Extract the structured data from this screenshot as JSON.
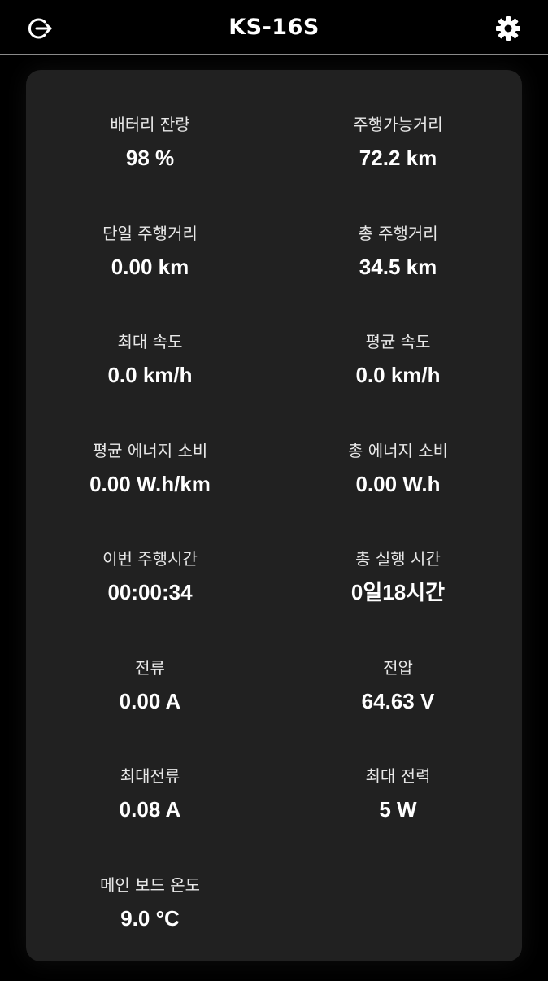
{
  "header": {
    "title": "KS-16S",
    "back_icon": "logout-icon",
    "settings_icon": "gear-icon"
  },
  "stats": [
    {
      "label": "배터리 잔량",
      "value": "98 %"
    },
    {
      "label": "주행가능거리",
      "value": "72.2 km"
    },
    {
      "label": "단일 주행거리",
      "value": "0.00 km"
    },
    {
      "label": "총 주행거리",
      "value": "34.5 km"
    },
    {
      "label": "최대 속도",
      "value": "0.0 km/h"
    },
    {
      "label": "평균 속도",
      "value": "0.0 km/h"
    },
    {
      "label": "평균 에너지 소비",
      "value": "0.00 W.h/km"
    },
    {
      "label": "총 에너지 소비",
      "value": "0.00 W.h"
    },
    {
      "label": "이번 주행시간",
      "value": "00:00:34"
    },
    {
      "label": "총 실행 시간",
      "value": "0일18시간"
    },
    {
      "label": "전류",
      "value": "0.00 A"
    },
    {
      "label": "전압",
      "value": "64.63 V"
    },
    {
      "label": "최대전류",
      "value": "0.08 A"
    },
    {
      "label": "최대 전력",
      "value": "5 W"
    },
    {
      "label": "메인 보드 온도",
      "value": "9.0 °C"
    }
  ],
  "colors": {
    "background": "#000000",
    "card": "#212121",
    "text": "#ffffff"
  }
}
